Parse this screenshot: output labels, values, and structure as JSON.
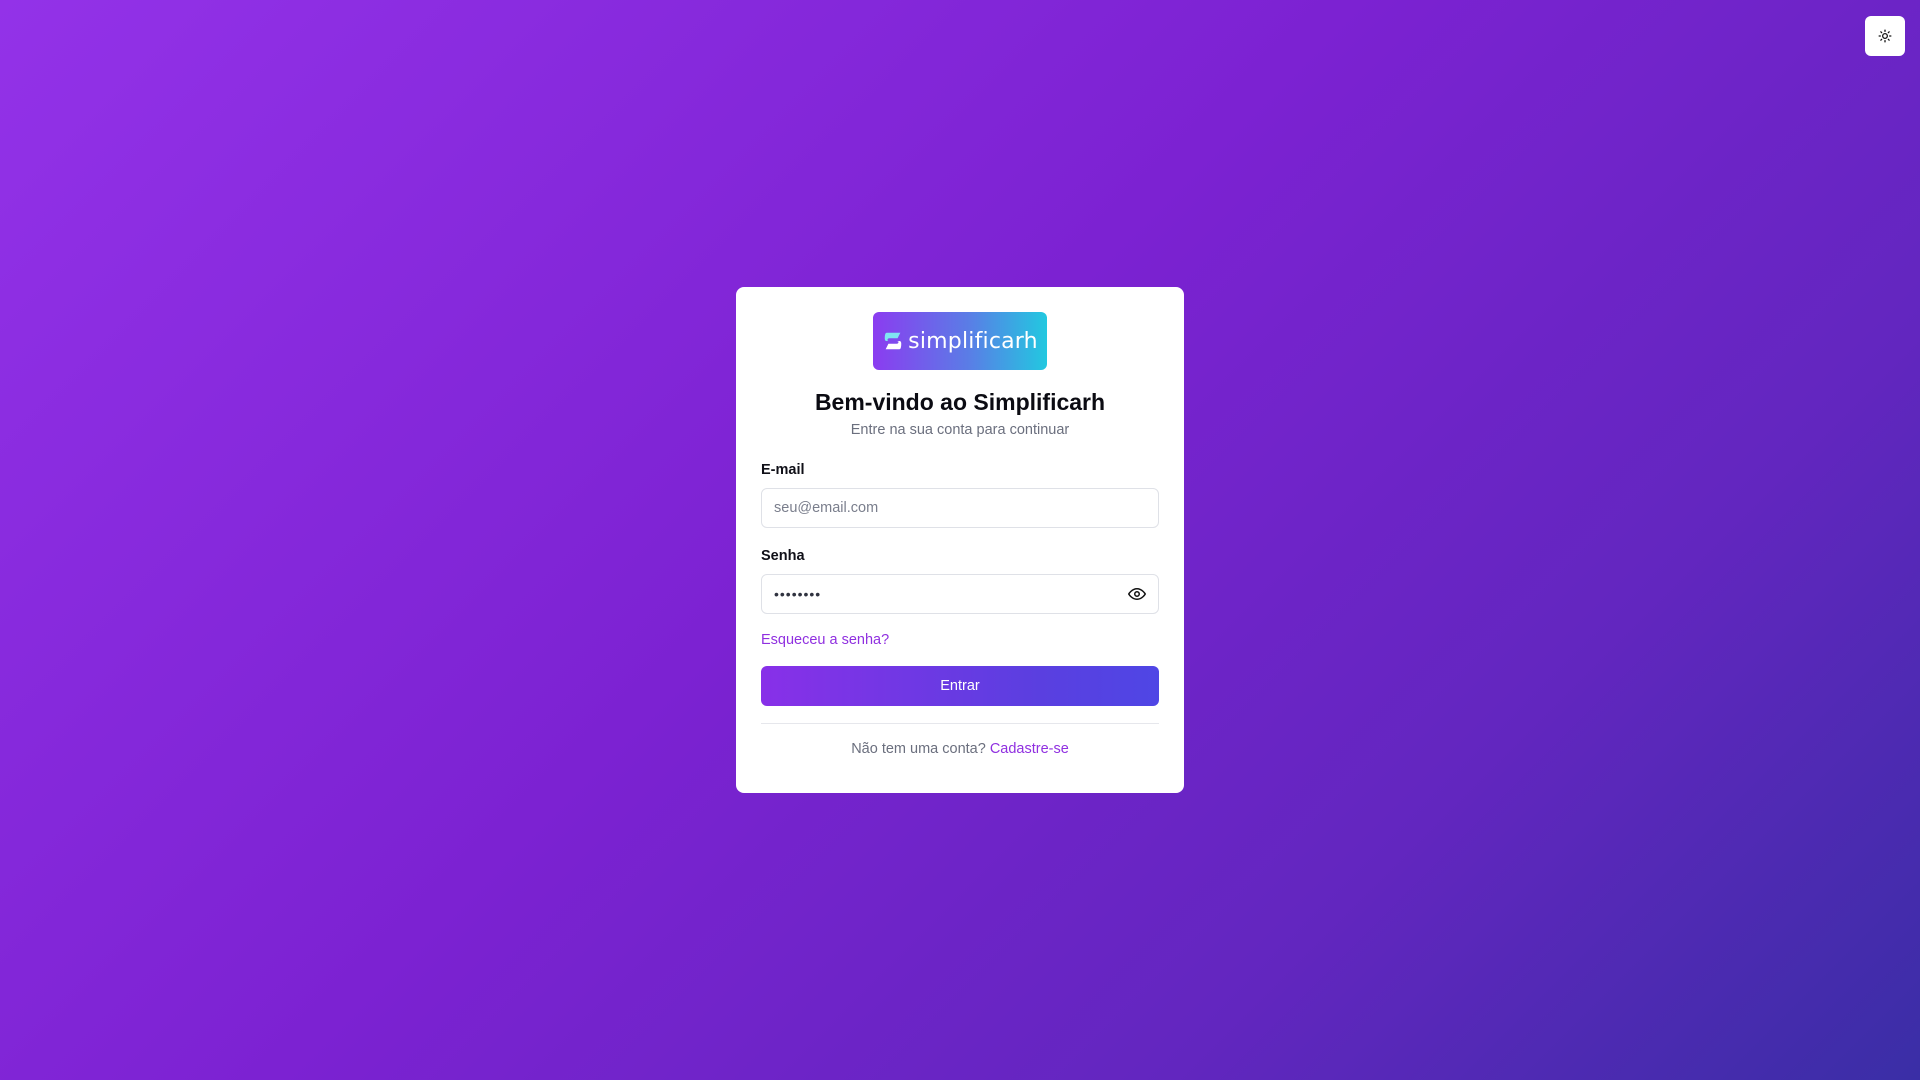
{
  "logo": {
    "text": "simplificarh"
  },
  "header": {
    "title": "Bem-vindo ao Simplificarh",
    "subtitle": "Entre na sua conta para continuar"
  },
  "email": {
    "label": "E-mail",
    "placeholder": "seu@email.com",
    "value": ""
  },
  "password": {
    "label": "Senha",
    "masked_value": "••••••••"
  },
  "forgot_link": "Esqueceu a senha?",
  "submit_label": "Entrar",
  "signup": {
    "prompt": "Não tem uma conta?",
    "link": "Cadastre-se"
  },
  "icons": {
    "theme_toggle": "sun-icon",
    "password_toggle": "eye-icon"
  },
  "colors": {
    "accent": "#9030e0",
    "button_start": "#8830e8",
    "button_end": "#4f46e5"
  }
}
